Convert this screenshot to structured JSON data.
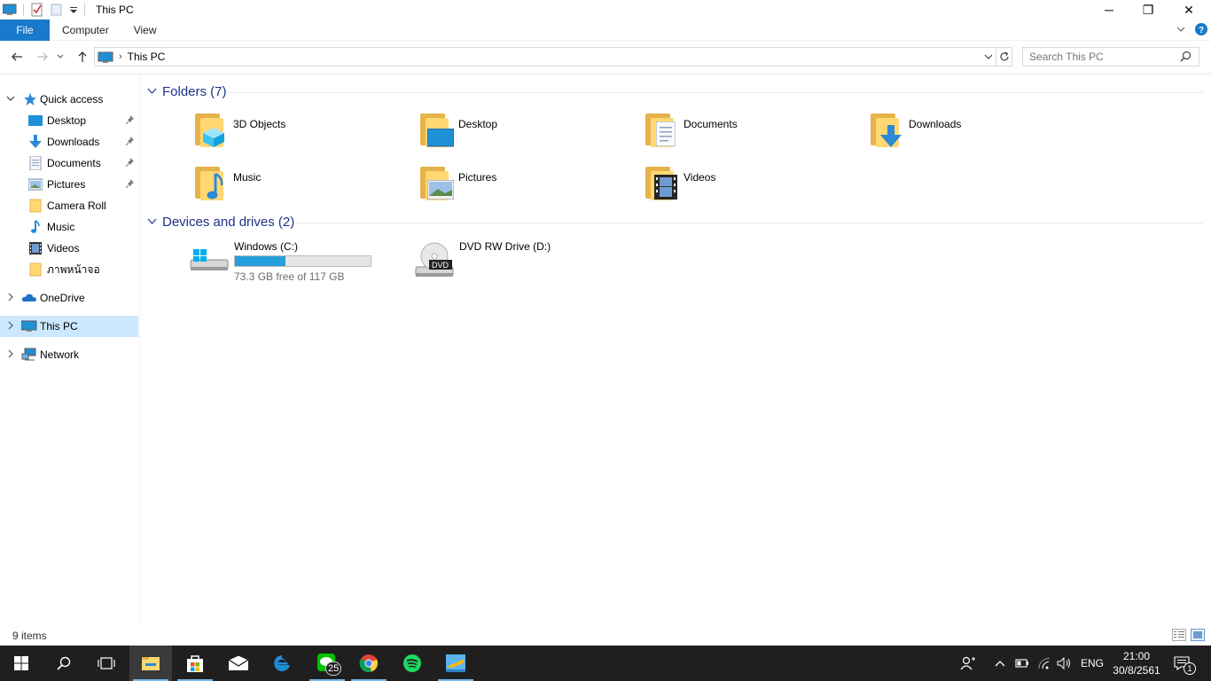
{
  "window": {
    "title": "This PC",
    "controls": {
      "minimize": "─",
      "maximize": "❐",
      "close": "✕"
    }
  },
  "ribbon": {
    "file_tab": "File",
    "tabs": [
      "Computer",
      "View"
    ]
  },
  "address": {
    "crumb": "This PC",
    "search_placeholder": "Search This PC"
  },
  "nav": {
    "quick_access": "Quick access",
    "quick_items": [
      {
        "label": "Desktop",
        "pinned": true
      },
      {
        "label": "Downloads",
        "pinned": true
      },
      {
        "label": "Documents",
        "pinned": true
      },
      {
        "label": "Pictures",
        "pinned": true
      },
      {
        "label": "Camera Roll",
        "pinned": false
      },
      {
        "label": "Music",
        "pinned": false
      },
      {
        "label": "Videos",
        "pinned": false
      },
      {
        "label": "ภาพหน้าจอ",
        "pinned": false
      }
    ],
    "onedrive": "OneDrive",
    "this_pc": "This PC",
    "network": "Network",
    "pin_glyph": "📌"
  },
  "content": {
    "folders_header": "Folders (7)",
    "folders": [
      "3D Objects",
      "Desktop",
      "Documents",
      "Downloads",
      "Music",
      "Pictures",
      "Videos"
    ],
    "drives_header": "Devices and drives (2)",
    "drives": [
      {
        "name": "Windows (C:)",
        "free": "73.3 GB free of 117 GB",
        "used_fraction": 0.373
      },
      {
        "name": "DVD RW Drive (D:)",
        "dvd_label": "DVD"
      }
    ]
  },
  "status": {
    "item_count": "9 items"
  },
  "taskbar": {
    "line_badge": "25",
    "lang": "ENG",
    "time": "21:00",
    "date": "30/8/2561",
    "notification_count": "1"
  },
  "colors": {
    "accent": "#1979ca",
    "selection": "#cce8ff",
    "group_header": "#1e3287",
    "drive_bar": "#26a0da",
    "folder_yellow": "#ffd872",
    "taskbar": "#1f1f1f"
  }
}
